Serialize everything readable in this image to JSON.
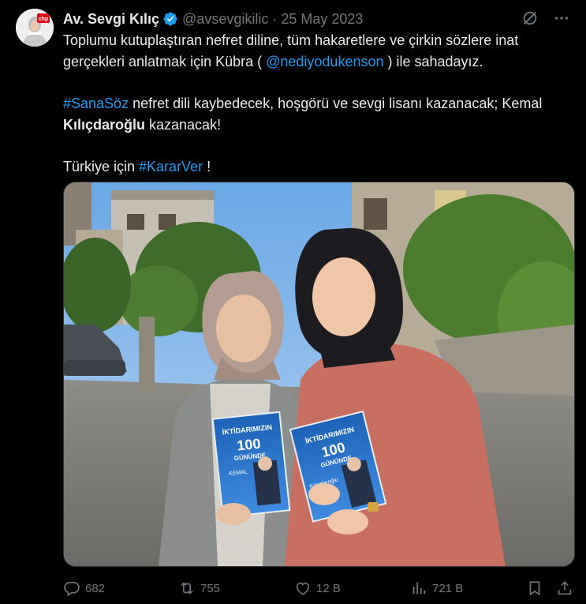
{
  "author": {
    "name": "Av. Sevgi Kılıç",
    "handle": "@avsevgikilic",
    "separator": "·",
    "date": "25 May 2023",
    "avatar_badge": "chp"
  },
  "tweet": {
    "line1": "Toplumu kutuplaştıran nefret diline, tüm hakaretlere ve çirkin sözlere inat",
    "line2_pre": "gerçekleri anlatmak için Kübra ( ",
    "mention": "@nediyodukenson",
    "line2_post": " ) ile sahadayız.",
    "hashtag1": "#SanaSöz",
    "line3_post": " nefret dili kaybedecek, hoşgörü ve sevgi lisanı kazanacak; Kemal",
    "bold_name": "Kılıçdaroğlu",
    "line4_post": " kazanacak!",
    "line5_pre": "Türkiye için ",
    "hashtag2": "#KararVer",
    "line5_post": " !"
  },
  "media": {
    "brochure_title_1": "İKTİDARIMIZIN",
    "brochure_num": "100",
    "brochure_title_2": "GÜNÜNDE",
    "brochure_name": "KEMAL",
    "brochure_sign": "Kılıçdaroğlu"
  },
  "actions": {
    "replies": "682",
    "reposts": "755",
    "likes": "12 B",
    "views": "721 B"
  },
  "colors": {
    "accent": "#1d9bf0",
    "muted": "#71767b",
    "text": "#e7e9ea",
    "background": "#000000"
  },
  "icons": [
    "verified-badge-icon",
    "grok-icon",
    "more-icon",
    "reply-icon",
    "repost-icon",
    "like-icon",
    "views-icon",
    "bookmark-icon",
    "share-icon"
  ]
}
